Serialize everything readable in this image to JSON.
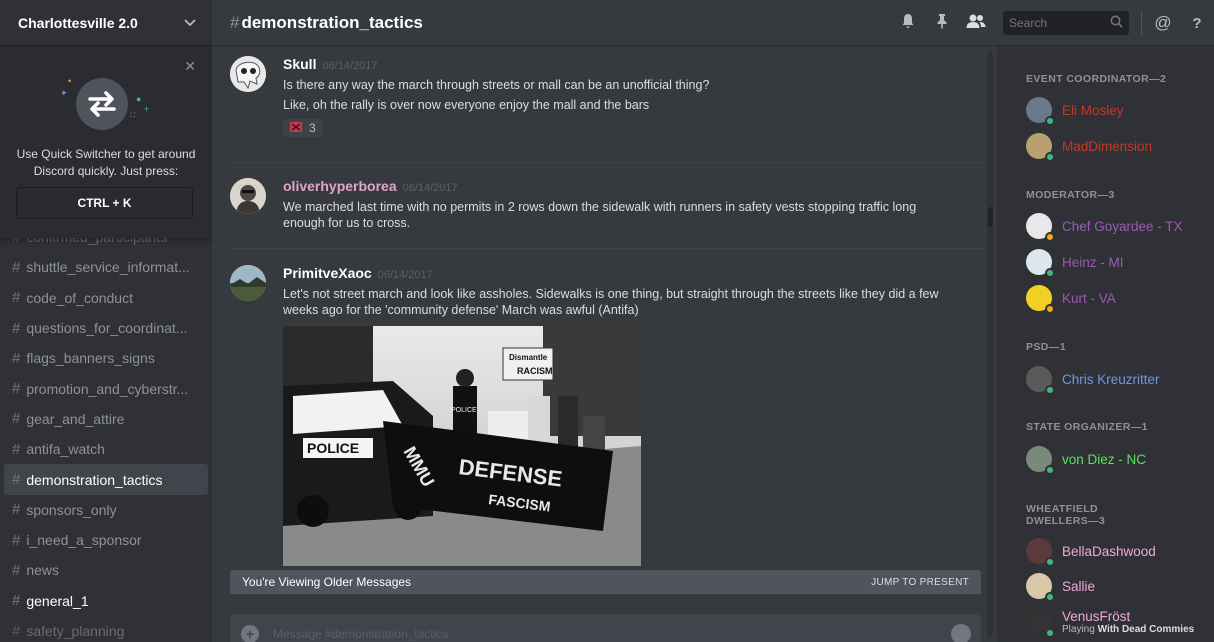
{
  "guild": {
    "name": "Charlottesville 2.0"
  },
  "quick_switcher": {
    "line1": "Use Quick Switcher to get around",
    "line2": "Discord quickly. Just press:",
    "shortcut": "CTRL + K"
  },
  "channels": [
    {
      "name": "confirmed_participants",
      "state": "faded"
    },
    {
      "name": "shuttle_service_informat...",
      "state": "normal"
    },
    {
      "name": "code_of_conduct",
      "state": "normal"
    },
    {
      "name": "questions_for_coordinat...",
      "state": "normal"
    },
    {
      "name": "flags_banners_signs",
      "state": "normal"
    },
    {
      "name": "promotion_and_cyberstr...",
      "state": "normal"
    },
    {
      "name": "gear_and_attire",
      "state": "normal"
    },
    {
      "name": "antifa_watch",
      "state": "normal"
    },
    {
      "name": "demonstration_tactics",
      "state": "active"
    },
    {
      "name": "sponsors_only",
      "state": "normal"
    },
    {
      "name": "i_need_a_sponsor",
      "state": "normal"
    },
    {
      "name": "news",
      "state": "normal"
    },
    {
      "name": "general_1",
      "state": "bright"
    },
    {
      "name": "safety_planning",
      "state": "faded"
    }
  ],
  "header": {
    "hash": "#",
    "channel": "demonstration_tactics",
    "search_placeholder": "Search"
  },
  "messages": [
    {
      "author": "Skull",
      "timestamp": "06/14/2017",
      "lines": [
        "Is there any way the march through streets or mall can be an unofficial thing?",
        "Like, oh the rally is over now everyone enjoy the mall and the bars"
      ],
      "reaction": {
        "icon": "emoji-icon",
        "count": "3"
      }
    },
    {
      "author": "oliverhyperborea",
      "timestamp": "06/14/2017",
      "text": "We marched last time with no permits in 2 rows down the sidewalk with runners in safety vests stopping traffic long enough for us to cross."
    },
    {
      "author": "PrimitveXaoc",
      "timestamp": "06/14/2017",
      "text": "Let's not street march and look like assholes. Sidewalks is one thing, but straight through the streets like they did a few weeks ago for the 'community defense' March was awful (Antifa)",
      "image_texts": [
        "Dismantle",
        "RACISM",
        "POLICE",
        "DEFENSE",
        "FASCISM"
      ]
    }
  ],
  "older_bar": {
    "label": "You're Viewing Older Messages",
    "jump": "JUMP TO PRESENT"
  },
  "composer": {
    "placeholder": "Message #demonstration_tactics"
  },
  "member_groups": [
    {
      "role": "EVENT COORDINATOR—2",
      "members": [
        {
          "name": "Eli Mosley",
          "color": "#c0392b",
          "status": "online"
        },
        {
          "name": "MadDimension",
          "color": "#c0392b",
          "status": "online"
        }
      ]
    },
    {
      "role": "MODERATOR—3",
      "members": [
        {
          "name": "Chef Goyardee - TX",
          "color": "#9b59b6",
          "status": "idle"
        },
        {
          "name": "Heinz - MI",
          "color": "#9b59b6",
          "status": "online"
        },
        {
          "name": "Kurt - VA",
          "color": "#9b59b6",
          "status": "idle"
        }
      ]
    },
    {
      "role": "PSD—1",
      "members": [
        {
          "name": "Chris Kreuzritter",
          "color": "#6f97e6",
          "status": "online"
        }
      ]
    },
    {
      "role": "STATE ORGANIZER—1",
      "members": [
        {
          "name": "von Diez - NC",
          "color": "#5ee05e",
          "status": "online"
        }
      ]
    },
    {
      "role_line1": "WHEATFIELD",
      "role_line2": "DWELLERS—3",
      "members": [
        {
          "name": "BellaDashwood",
          "color": "#f1a8d8",
          "status": "online"
        },
        {
          "name": "Sallie",
          "color": "#f1a8d8",
          "status": "online"
        },
        {
          "name": "VenusFröst",
          "color": "#f1a8d8",
          "status": "online",
          "activity_prefix": "Playing",
          "activity": "With Dead Commies"
        }
      ]
    }
  ],
  "colors": {
    "online": "#43b581",
    "idle": "#faa61a",
    "accent": "#7289da"
  }
}
